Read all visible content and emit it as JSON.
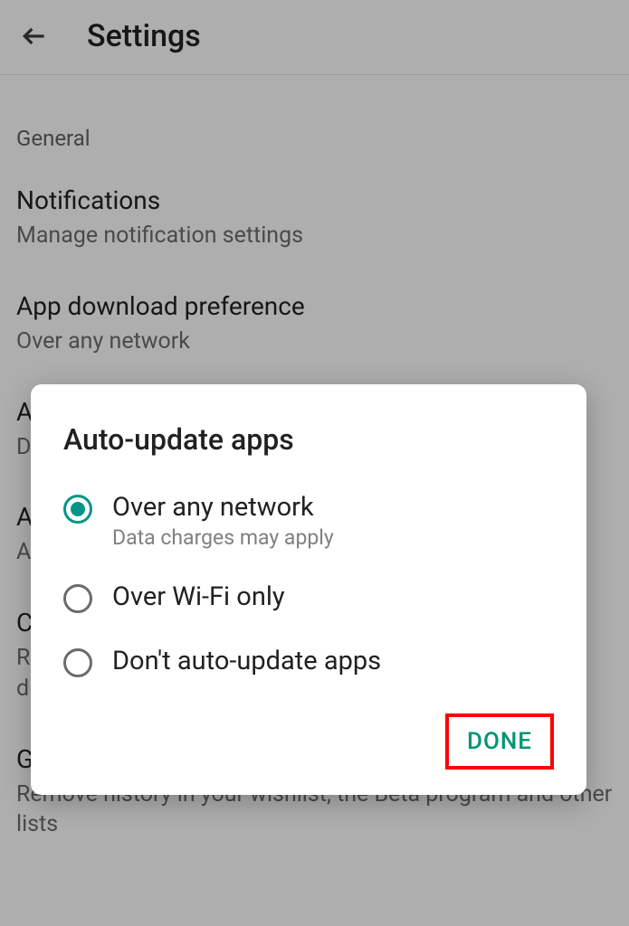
{
  "header": {
    "title": "Settings"
  },
  "sections": {
    "general_label": "General",
    "notifications": {
      "title": "Notifications",
      "sub": "Manage notification settings"
    },
    "app_download": {
      "title": "App download preference",
      "sub": "Over any network"
    },
    "auto_update_bg": {
      "title_first_char": "A",
      "sub_first_char": "D"
    },
    "item_a": {
      "title_first_char": "A",
      "sub_first_char": "A"
    },
    "item_c": {
      "title_first_char": "C",
      "sub_line1": "R",
      "sub_line2": "d"
    },
    "google_play": {
      "title_first_char": "G",
      "sub": "Remove history in your wishlist, the Beta program and other lists"
    }
  },
  "dialog": {
    "title": "Auto-update apps",
    "options": [
      {
        "label": "Over any network",
        "sub": "Data charges may apply",
        "selected": true
      },
      {
        "label": "Over Wi-Fi only",
        "sub": "",
        "selected": false
      },
      {
        "label": "Don't auto-update apps",
        "sub": "",
        "selected": false
      }
    ],
    "done_label": "DONE"
  }
}
